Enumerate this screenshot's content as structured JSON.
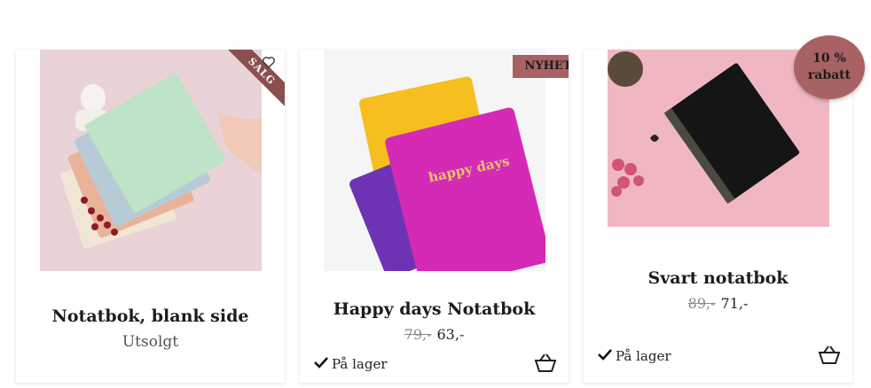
{
  "products": [
    {
      "title": "Notatbok, blank side",
      "status": "Utsolgt",
      "badge": "SALG",
      "image_icon": "notebooks-fan-photo",
      "wishlist_icon": "heart-icon"
    },
    {
      "title": "Happy days Notatbok",
      "badge": "NYHET",
      "cover_text": "happy days",
      "old_price": "79,-",
      "price": "63,-",
      "stock": "På lager",
      "image_icon": "happy-days-notebooks-photo"
    },
    {
      "title": "Svart notatbok",
      "badge_line1": "10 %",
      "badge_line2": "rabatt",
      "old_price": "89,-",
      "price": "71,-",
      "stock": "På lager",
      "image_icon": "black-notebook-photo"
    }
  ],
  "colors": {
    "badge": "#a86263",
    "ribbon": "#8b4f50"
  }
}
